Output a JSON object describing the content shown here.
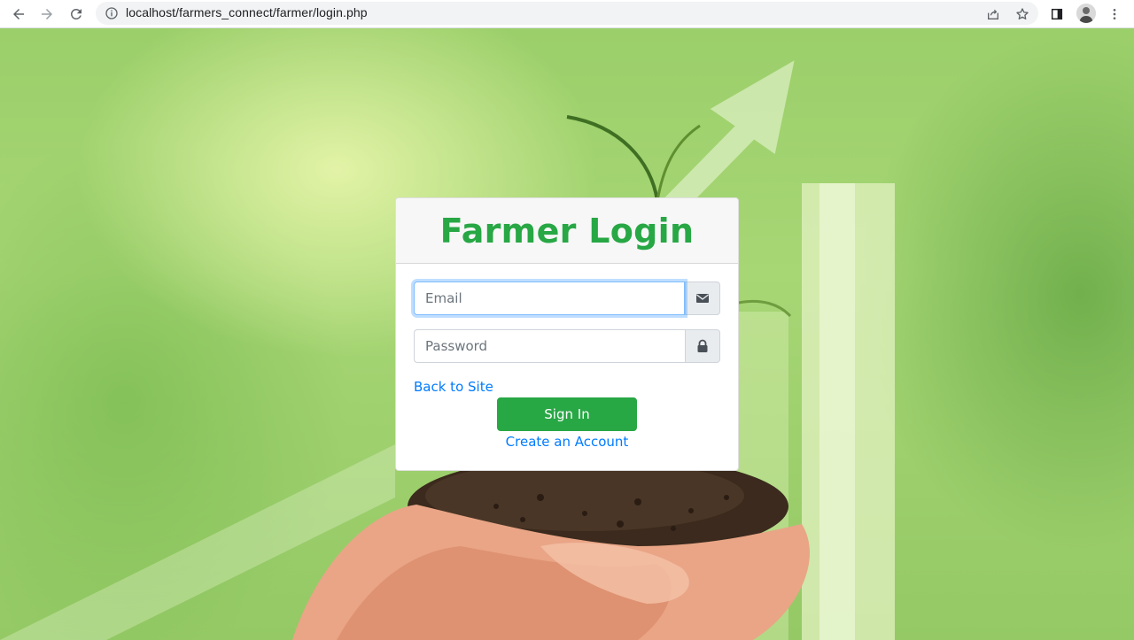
{
  "browser": {
    "url": "localhost/farmers_connect/farmer/login.php",
    "icons": {
      "back": "arrow-left-icon",
      "forward": "arrow-right-icon",
      "reload": "reload-icon",
      "site_info": "info-icon",
      "share": "share-icon",
      "bookmark": "star-icon",
      "side_panel": "side-panel-icon",
      "profile": "avatar",
      "menu": "kebab-menu-icon"
    }
  },
  "login": {
    "title": "Farmer Login",
    "email_placeholder": "Email",
    "email_value": "",
    "password_placeholder": "Password",
    "password_value": "",
    "email_icon": "envelope-icon",
    "password_icon": "lock-icon",
    "back_link": "Back to Site",
    "submit": "Sign In",
    "create_link": "Create an Account"
  },
  "colors": {
    "brand_green": "#28a745",
    "link_blue": "#007bff",
    "focus_ring": "#80bdff"
  }
}
